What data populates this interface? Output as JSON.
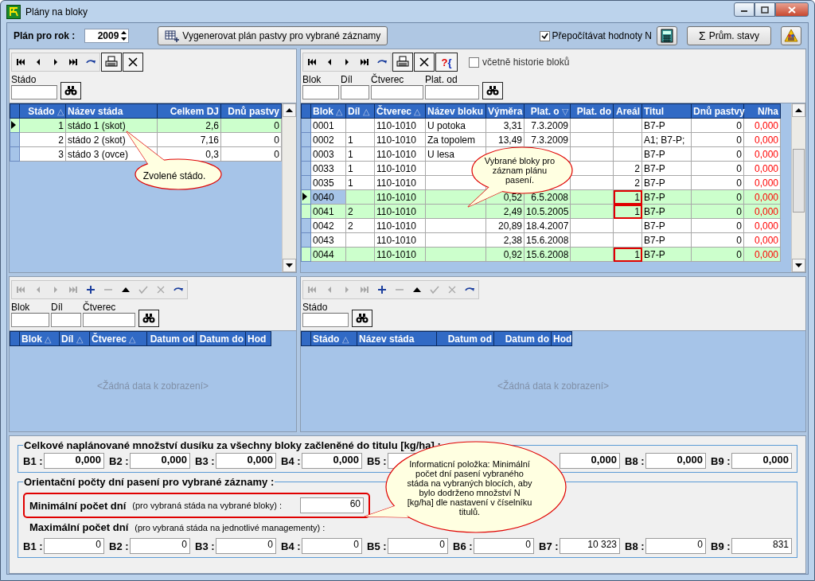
{
  "window": {
    "title": "Plány na bloky"
  },
  "toolbar": {
    "year_label": "Plán pro rok :",
    "year": "2009",
    "generate_button": "Vygenerovat plán pastvy pro vybrané záznamy",
    "recalc_checkbox": {
      "label": "Přepočítávat hodnoty N",
      "checked": true
    },
    "averages_symbol": "Σ",
    "averages_button": "Prům. stavy"
  },
  "herds_panel": {
    "tools": [
      {
        "kind": "first",
        "disabled": false
      },
      {
        "kind": "prev",
        "disabled": false
      },
      {
        "kind": "next",
        "disabled": false
      },
      {
        "kind": "last",
        "disabled": false
      },
      {
        "kind": "refresh",
        "disabled": false
      },
      {
        "kind": "print",
        "disabled": false
      },
      {
        "kind": "delete",
        "disabled": false
      }
    ],
    "filters": [
      {
        "label": "Stádo"
      }
    ],
    "columns": [
      {
        "label": "Stádo",
        "sort_mark": "△"
      },
      {
        "label": "Název stáda"
      },
      {
        "label": "Celkem DJ"
      },
      {
        "label": "Dnů pastvy"
      }
    ],
    "rows": [
      {
        "cells": [
          "1",
          "stádo 1 (skot)",
          "2,6",
          "0"
        ],
        "selected": true,
        "current": true
      },
      {
        "cells": [
          "2",
          "stádo 2 (skot)",
          "7,16",
          "0"
        ],
        "selected": false,
        "current": false
      },
      {
        "cells": [
          "3",
          "stádo 3 (ovce)",
          "0,3",
          "0"
        ],
        "selected": false,
        "current": false
      }
    ],
    "callout": "Zvolené stádo."
  },
  "blocks_panel": {
    "tools": [
      {
        "kind": "first",
        "disabled": false
      },
      {
        "kind": "prev",
        "disabled": false
      },
      {
        "kind": "next",
        "disabled": false
      },
      {
        "kind": "last",
        "disabled": false
      },
      {
        "kind": "refresh",
        "disabled": false
      },
      {
        "kind": "print",
        "disabled": false
      },
      {
        "kind": "delete",
        "disabled": false
      }
    ],
    "query_button": "?{",
    "history_checkbox": {
      "label": "včetně historie bloků",
      "checked": false
    },
    "filters": [
      {
        "label": "Blok"
      },
      {
        "label": "Díl"
      },
      {
        "label": "Čtverec"
      },
      {
        "label": "Plat. od"
      }
    ],
    "columns": [
      {
        "label": "Blok",
        "sort_mark": "△"
      },
      {
        "label": "Díl",
        "sort_mark": "△"
      },
      {
        "label": "Čtverec",
        "sort_mark": "△"
      },
      {
        "label": "Název bloku"
      },
      {
        "label": "Výměra"
      },
      {
        "label": "Plat. o",
        "sort_mark": "▽"
      },
      {
        "label": "Plat. do"
      },
      {
        "label": "Areál"
      },
      {
        "label": "Titul"
      },
      {
        "label": "Dnů pastvy"
      },
      {
        "label": "N/ha",
        "color": "#ff0000"
      }
    ],
    "rows": [
      {
        "cells": [
          "0001",
          null,
          "110-1010",
          "U potoka",
          "3,31",
          "7.3.2009",
          null,
          null,
          "B7-P",
          "0",
          "0,000"
        ],
        "selected": false,
        "current": false,
        "areal_marked": false
      },
      {
        "cells": [
          "0002",
          "1",
          "110-1010",
          "Za topolem",
          "13,49",
          "7.3.2009",
          null,
          null,
          "A1; B7-P;",
          "0",
          "0,000"
        ],
        "selected": false,
        "current": false,
        "areal_marked": false
      },
      {
        "cells": [
          "0003",
          "1",
          "110-1010",
          "U lesa",
          null,
          null,
          null,
          null,
          "B7-P",
          "0",
          "0,000"
        ],
        "selected": false,
        "current": false,
        "areal_marked": false
      },
      {
        "cells": [
          "0033",
          "1",
          "110-1010",
          null,
          null,
          null,
          null,
          "2",
          "B7-P",
          "0",
          "0,000"
        ],
        "selected": false,
        "current": false,
        "areal_marked": false
      },
      {
        "cells": [
          "0035",
          "1",
          "110-1010",
          null,
          null,
          null,
          null,
          "2",
          "B7-P",
          "0",
          "0,000"
        ],
        "selected": false,
        "current": false,
        "areal_marked": false
      },
      {
        "cells": [
          "0040",
          null,
          "110-1010",
          null,
          "0,52",
          "6.5.2008",
          null,
          "1",
          "B7-P",
          "0",
          "0,000"
        ],
        "selected": true,
        "current": true,
        "areal_marked": true
      },
      {
        "cells": [
          "0041",
          "2",
          "110-1010",
          null,
          "2,49",
          "10.5.2005",
          null,
          "1",
          "B7-P",
          "0",
          "0,000"
        ],
        "selected": true,
        "current": false,
        "areal_marked": true
      },
      {
        "cells": [
          "0042",
          "2",
          "110-1010",
          null,
          "20,89",
          "18.4.2007",
          null,
          null,
          "B7-P",
          "0",
          "0,000"
        ],
        "selected": false,
        "current": false,
        "areal_marked": false
      },
      {
        "cells": [
          "0043",
          null,
          "110-1010",
          null,
          "2,38",
          "15.6.2008",
          null,
          null,
          "B7-P",
          "0",
          "0,000"
        ],
        "selected": false,
        "current": false,
        "areal_marked": false
      },
      {
        "cells": [
          "0044",
          null,
          "110-1010",
          null,
          "0,92",
          "15.6.2008",
          null,
          "1",
          "B7-P",
          "0",
          "0,000"
        ],
        "selected": true,
        "current": false,
        "areal_marked": true
      }
    ],
    "callout": "Vybrané bloky pro záznam plánu pasení."
  },
  "block_links_panel": {
    "tools": [
      {
        "kind": "first",
        "disabled": true
      },
      {
        "kind": "prev",
        "disabled": true
      },
      {
        "kind": "next",
        "disabled": true
      },
      {
        "kind": "last",
        "disabled": true
      },
      {
        "kind": "add",
        "disabled": false
      },
      {
        "kind": "remove",
        "disabled": true
      },
      {
        "kind": "up",
        "disabled": false
      },
      {
        "kind": "confirm",
        "disabled": true
      },
      {
        "kind": "cancel",
        "disabled": true
      },
      {
        "kind": "refresh",
        "disabled": false
      }
    ],
    "filters": [
      {
        "label": "Blok"
      },
      {
        "label": "Díl"
      },
      {
        "label": "Čtverec"
      }
    ],
    "columns": [
      {
        "label": "Blok",
        "sort_mark": "△"
      },
      {
        "label": "Díl",
        "sort_mark": "△"
      },
      {
        "label": "Čtverec",
        "sort_mark": "△"
      },
      {
        "label": "Datum od"
      },
      {
        "label": "Datum do"
      },
      {
        "label": "Hod"
      }
    ],
    "empty_text": "<Žádná data k zobrazení>"
  },
  "herd_links_panel": {
    "tools": [
      {
        "kind": "first",
        "disabled": true
      },
      {
        "kind": "prev",
        "disabled": true
      },
      {
        "kind": "next",
        "disabled": true
      },
      {
        "kind": "last",
        "disabled": true
      },
      {
        "kind": "add",
        "disabled": false
      },
      {
        "kind": "remove",
        "disabled": true
      },
      {
        "kind": "up",
        "disabled": false
      },
      {
        "kind": "confirm",
        "disabled": true
      },
      {
        "kind": "cancel",
        "disabled": true
      },
      {
        "kind": "refresh",
        "disabled": false
      }
    ],
    "filters": [
      {
        "label": "Stádo"
      }
    ],
    "columns": [
      {
        "label": "Stádo",
        "sort_mark": "△"
      },
      {
        "label": "Název stáda"
      },
      {
        "label": "Datum od"
      },
      {
        "label": "Datum do"
      },
      {
        "label": "Hod"
      }
    ],
    "empty_text": "<Žádná data k zobrazení>"
  },
  "nitrogen_group": {
    "title": "Celkové naplánované množství dusíku za všechny bloky začleněné do titulu [kg/ha] :",
    "items": [
      {
        "label": "B1 :",
        "value": "0,000"
      },
      {
        "label": "B2 :",
        "value": "0,000"
      },
      {
        "label": "B3 :",
        "value": "0,000"
      },
      {
        "label": "B4 :",
        "value": "0,000"
      },
      {
        "label": "B5 :"
      }
    ],
    "right_items": [
      {
        "value": "0,000"
      },
      {
        "label": "B8 :",
        "value": "0,000"
      },
      {
        "label": "B9 :",
        "value": "0,000"
      }
    ]
  },
  "days_group": {
    "title": "Orientační počty dní pasení pro vybrané záznamy :",
    "min": {
      "label": "Minimální počet dní",
      "note": "(pro vybraná stáda na vybrané bloky) :",
      "value": "60",
      "highlighted": true
    },
    "max": {
      "label": "Maximální počet dní",
      "note": "(pro vybraná stáda na jednotlivé managementy) :"
    },
    "items": [
      {
        "label": "B1 :",
        "value": "0"
      },
      {
        "label": "B2 :",
        "value": "0"
      },
      {
        "label": "B3 :",
        "value": "0"
      },
      {
        "label": "B4 :",
        "value": "0"
      },
      {
        "label": "B5 :",
        "value": "0"
      },
      {
        "label": "B6 :",
        "value": "0"
      },
      {
        "label": "B7 :",
        "value": "10 323"
      },
      {
        "label": "B8 :",
        "value": "0"
      },
      {
        "label": "B9 :",
        "value": "831"
      }
    ],
    "callout": "Informaticní položka: Minimální počet dní pasení vybraného stáda na vybraných blocích, aby bylo dodrženo množství N [kg/ha] dle nastavení v číselníku titulů."
  }
}
